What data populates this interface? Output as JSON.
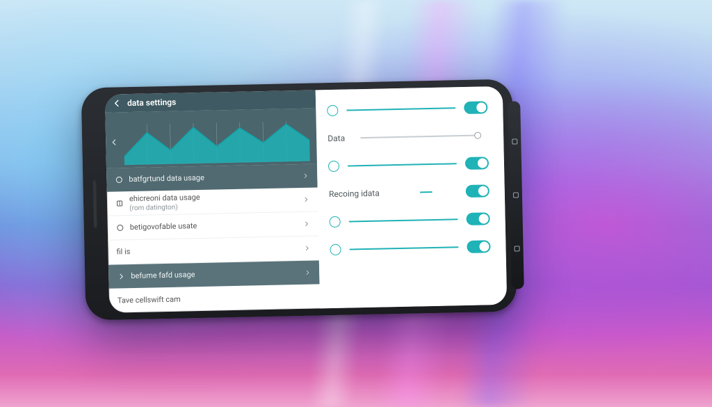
{
  "colors": {
    "accent": "#1fb2b6",
    "header": "#3f5a62",
    "panel": "#4b656d"
  },
  "header": {
    "title": "data settings"
  },
  "chart_data": {
    "type": "area",
    "x": [
      0,
      1,
      2,
      3,
      4,
      5,
      6,
      7
    ],
    "values": [
      10,
      40,
      18,
      48,
      22,
      46,
      26,
      50
    ],
    "ylim": [
      0,
      60
    ],
    "grid": true,
    "title": "",
    "xlabel": "",
    "ylabel": ""
  },
  "left": {
    "items": [
      {
        "label": "batfgrtund data usage",
        "icon": "circle-icon",
        "style": "dk pale"
      },
      {
        "label": "ehicreoni data usage",
        "sub": "(rom datington)",
        "icon": "info-icon",
        "style": ""
      },
      {
        "label": "betigovofable usate",
        "icon": "circle-icon",
        "style": ""
      },
      {
        "label": "fil is",
        "icon": "",
        "style": ""
      },
      {
        "label": "befume fafd usage",
        "icon": "chevron-right-icon",
        "style": "dk"
      },
      {
        "label": "Tave cellswift cam",
        "icon": "",
        "style": ""
      }
    ]
  },
  "right": {
    "rows": [
      {
        "kind": "slider-toggle",
        "label": ""
      },
      {
        "kind": "labeled-slider",
        "label": "Data"
      },
      {
        "kind": "slider-toggle",
        "label": ""
      },
      {
        "kind": "labeled-toggle",
        "label": "Recoing idata"
      },
      {
        "kind": "slider-toggle",
        "label": ""
      },
      {
        "kind": "slider-toggle",
        "label": ""
      }
    ]
  }
}
